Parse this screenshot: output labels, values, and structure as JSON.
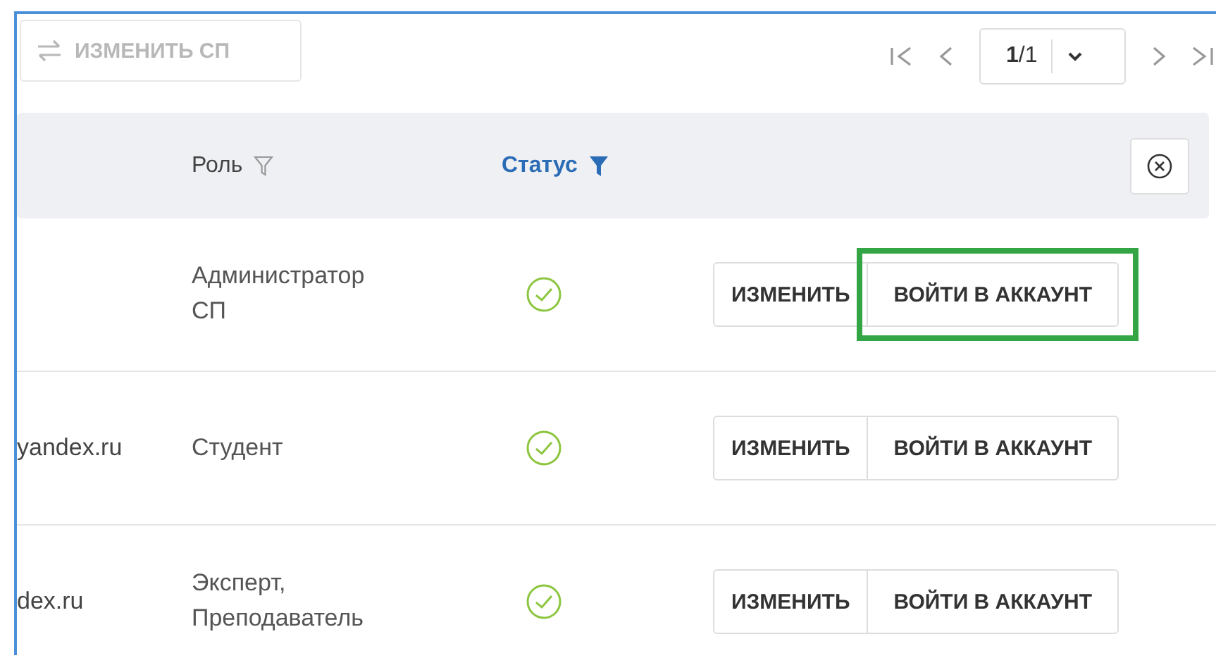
{
  "toolbar": {
    "change_button": {
      "label": "ИЗМЕНИТЬ СП",
      "disabled": true
    }
  },
  "pagination": {
    "page": "1",
    "total": "/1"
  },
  "table": {
    "columns": [
      {
        "label": "Роль",
        "filter_active": false
      },
      {
        "label": "Статус",
        "filter_active": true
      }
    ],
    "rows": [
      {
        "email": "",
        "role": "Администратор СП",
        "status_ok": true,
        "edit": "ИЗМЕНИТЬ",
        "login": "ВОЙТИ В АККАУНТ",
        "highlighted": true
      },
      {
        "email": "yandex.ru",
        "role": "Студент",
        "status_ok": true,
        "edit": "ИЗМЕНИТЬ",
        "login": "ВОЙТИ В АККАУНТ",
        "highlighted": false
      },
      {
        "email": "dex.ru",
        "role": "Эксперт, Преподаватель",
        "status_ok": true,
        "edit": "ИЗМЕНИТЬ",
        "login": "ВОЙТИ В АККАУНТ",
        "highlighted": false
      }
    ]
  }
}
